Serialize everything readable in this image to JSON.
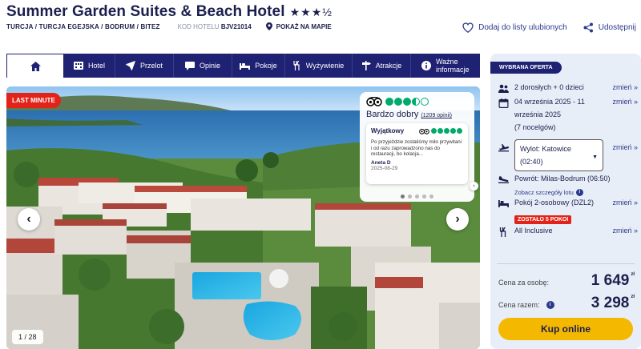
{
  "header": {
    "hotel_name": "Summer Garden Suites & Beach Hotel",
    "stars": "★★★½",
    "breadcrumb": "TURCJA / TURCJA EGEJSKA / BODRUM / BITEZ",
    "code_label": "KOD HOTELU",
    "code_value": "BJV21014",
    "map_label": "POKAŻ NA MAPIE",
    "favorite_label": "Dodaj do listy ulubionych",
    "share_label": "Udostępnij"
  },
  "nav": {
    "items": [
      {
        "label": "",
        "icon": "home-icon"
      },
      {
        "label": "Hotel",
        "icon": "hotel-icon"
      },
      {
        "label": "Przelot",
        "icon": "plane-icon"
      },
      {
        "label": "Opinie",
        "icon": "speech-bubble-icon"
      },
      {
        "label": "Pokoje",
        "icon": "bed-icon"
      },
      {
        "label": "Wyżywienie",
        "icon": "cutlery-icon"
      },
      {
        "label": "Atrakcje",
        "icon": "signpost-icon"
      },
      {
        "label": "Ważne informacje",
        "icon": "info-icon"
      }
    ]
  },
  "gallery": {
    "badge": "LAST MINUTE",
    "counter": "1 / 28"
  },
  "review": {
    "rating_bubbles": 3.5,
    "rating_word": "Bardzo dobry",
    "reviews_count": "(1209 opinii)",
    "item_title": "Wyjątkowy",
    "item_bubbles": 5,
    "item_text": "Po przyjeździe zostaliśmy miło przywitani i od razu zaprowadzono nas do restauracji, bo kolacja...",
    "author": "Aneta D",
    "date": "2025-08-29",
    "dots_total": 5,
    "dots_active": 1
  },
  "offer": {
    "tag": "WYBRANA OFERTA",
    "change_label": "zmień »",
    "travellers": "2 dorosłych + 0 dzieci",
    "dates_line1": "04 września 2025 - 11",
    "dates_line2": "września 2025",
    "dates_line3": "(7 nocelgów)",
    "departure_line1": "Wylot: Katowice",
    "departure_line2": "(02:40)",
    "return": "Powrót: Milas-Bodrum (06:50)",
    "flight_details": "Zobacz szczegóły lotu",
    "room": "Pokój 2-osobowy (DZL2)",
    "rooms_left": "ZOSTAŁO 5 POKOI",
    "board": "All Inclusive",
    "price_per_person_label": "Cena za osobę:",
    "price_per_person": "1 649",
    "price_total_label": "Cena razem:",
    "price_total": "3 298",
    "currency": "zł",
    "buy_label": "Kup online"
  },
  "colors": {
    "navy": "#1f2173",
    "accent_red": "#e2231a",
    "buy_yellow": "#f5b800",
    "tripadvisor_green": "#00aa6c",
    "panel_bg": "#e8eef7"
  }
}
